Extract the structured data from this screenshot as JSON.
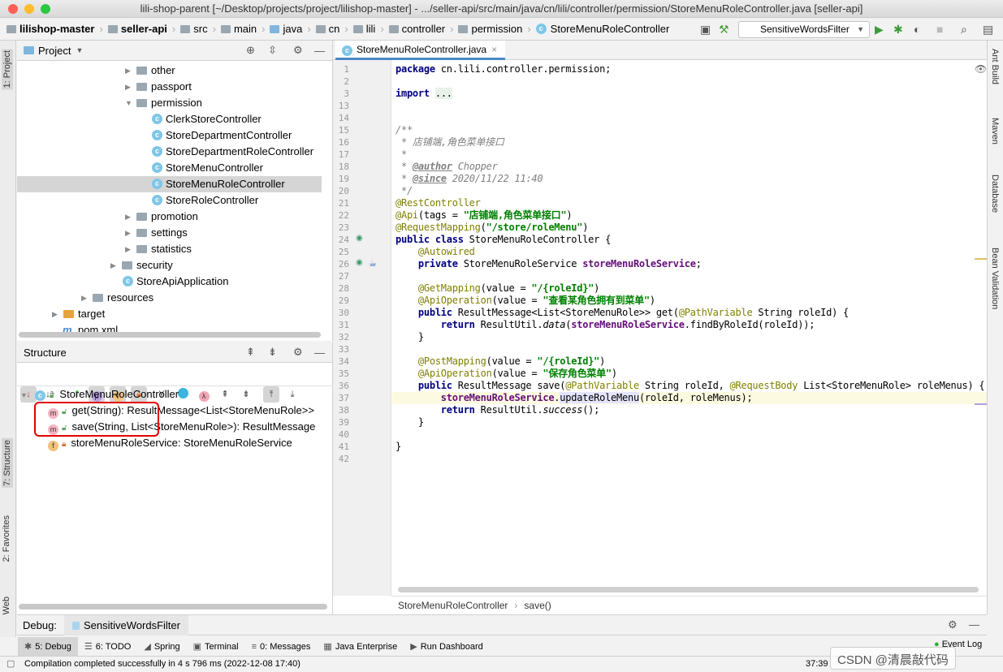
{
  "window": {
    "title": "lili-shop-parent [~/Desktop/projects/project/lilishop-master] - .../seller-api/src/main/java/cn/lili/controller/permission/StoreMenuRoleController.java [seller-api]"
  },
  "breadcrumbs": [
    "lilishop-master",
    "seller-api",
    "src",
    "main",
    "java",
    "cn",
    "lili",
    "controller",
    "permission",
    "StoreMenuRoleController"
  ],
  "run_config": {
    "selected": "SensitiveWordsFilter"
  },
  "left_strip": {
    "project": "1: Project",
    "structure": "7: Structure",
    "favorites": "2: Favorites",
    "web": "Web"
  },
  "right_strip": {
    "ant": "Ant Build",
    "maven": "Maven",
    "database": "Database",
    "bean": "Bean Validation"
  },
  "project_panel": {
    "title": "Project",
    "items": [
      {
        "label": "other",
        "type": "folder"
      },
      {
        "label": "passport",
        "type": "folder"
      },
      {
        "label": "permission",
        "type": "folder",
        "expanded": true
      },
      {
        "label": "ClerkStoreController",
        "type": "class"
      },
      {
        "label": "StoreDepartmentController",
        "type": "class"
      },
      {
        "label": "StoreDepartmentRoleController",
        "type": "class"
      },
      {
        "label": "StoreMenuController",
        "type": "class"
      },
      {
        "label": "StoreMenuRoleController",
        "type": "class",
        "selected": true
      },
      {
        "label": "StoreRoleController",
        "type": "class"
      },
      {
        "label": "promotion",
        "type": "folder"
      },
      {
        "label": "settings",
        "type": "folder"
      },
      {
        "label": "statistics",
        "type": "folder"
      },
      {
        "label": "security",
        "type": "folder"
      },
      {
        "label": "StoreApiApplication",
        "type": "app"
      },
      {
        "label": "resources",
        "type": "folder"
      },
      {
        "label": "target",
        "type": "folder-orange"
      },
      {
        "label": "pom.xml",
        "type": "maven"
      }
    ]
  },
  "structure_panel": {
    "title": "Structure",
    "root": "StoreMenuRoleController",
    "members": [
      {
        "badge": "m",
        "label": "get(String): ResultMessage<List<StoreMenuRole>>"
      },
      {
        "badge": "m",
        "label": "save(String, List<StoreMenuRole>): ResultMessage"
      },
      {
        "badge": "f",
        "label": "storeMenuRoleService: StoreMenuRoleService"
      }
    ],
    "toolbar_badges": {
      "p": "p",
      "f": "f",
      "lambda": "λ"
    }
  },
  "editor": {
    "tab": "StoreMenuRoleController.java",
    "breadcrumb": [
      "StoreMenuRoleController",
      "save()"
    ],
    "current_line": 37,
    "lines": [
      {
        "n": "1",
        "t": [
          [
            "package",
            "kw"
          ],
          [
            " cn.lili.controller.permission;",
            ""
          ]
        ]
      },
      {
        "n": "2",
        "t": []
      },
      {
        "n": "3",
        "t": [
          [
            "import",
            "kw"
          ],
          [
            " ",
            ""
          ],
          [
            "...",
            "fold"
          ]
        ]
      },
      {
        "n": "13",
        "t": []
      },
      {
        "n": "14",
        "t": []
      },
      {
        "n": "15",
        "t": [
          [
            "/**",
            "cm"
          ]
        ]
      },
      {
        "n": "16",
        "t": [
          [
            " * 店铺端,角色菜单接口",
            "cm"
          ]
        ]
      },
      {
        "n": "17",
        "t": [
          [
            " *",
            "cm"
          ]
        ]
      },
      {
        "n": "18",
        "t": [
          [
            " * ",
            "cm"
          ],
          [
            "@author",
            "ct"
          ],
          [
            " Chopper",
            "cm"
          ]
        ]
      },
      {
        "n": "19",
        "t": [
          [
            " * ",
            "cm"
          ],
          [
            "@since",
            "ct"
          ],
          [
            " 2020/11/22 11:40",
            "cm"
          ]
        ]
      },
      {
        "n": "20",
        "t": [
          [
            " */",
            "cm"
          ]
        ]
      },
      {
        "n": "21",
        "t": [
          [
            "@RestController",
            "an"
          ]
        ]
      },
      {
        "n": "22",
        "t": [
          [
            "@Api",
            "an"
          ],
          [
            "(tags = ",
            ""
          ],
          [
            "\"店铺端,角色菜单接口\"",
            "st"
          ],
          [
            ")",
            ""
          ]
        ]
      },
      {
        "n": "23",
        "t": [
          [
            "@RequestMapping",
            "an"
          ],
          [
            "(",
            ""
          ],
          [
            "\"/store/roleMenu\"",
            "st"
          ],
          [
            ")",
            ""
          ]
        ]
      },
      {
        "n": "24",
        "t": [
          [
            "public class",
            "kw"
          ],
          [
            " StoreMenuRoleController {",
            ""
          ]
        ]
      },
      {
        "n": "25",
        "t": [
          [
            "    ",
            ""
          ],
          [
            "@Autowired",
            "an"
          ]
        ]
      },
      {
        "n": "26",
        "t": [
          [
            "    ",
            ""
          ],
          [
            "private",
            "kw"
          ],
          [
            " StoreMenuRoleService ",
            ""
          ],
          [
            "storeMenuRoleService",
            "fd"
          ],
          [
            ";",
            ""
          ]
        ]
      },
      {
        "n": "27",
        "t": []
      },
      {
        "n": "28",
        "t": [
          [
            "    ",
            ""
          ],
          [
            "@GetMapping",
            "an"
          ],
          [
            "(value = ",
            ""
          ],
          [
            "\"/{roleId}\"",
            "st"
          ],
          [
            ")",
            ""
          ]
        ]
      },
      {
        "n": "29",
        "t": [
          [
            "    ",
            ""
          ],
          [
            "@ApiOperation",
            "an"
          ],
          [
            "(value = ",
            ""
          ],
          [
            "\"查看某角色拥有到菜单\"",
            "st"
          ],
          [
            ")",
            ""
          ]
        ]
      },
      {
        "n": "30",
        "t": [
          [
            "    ",
            ""
          ],
          [
            "public",
            "kw"
          ],
          [
            " ResultMessage<List<StoreMenuRole>> get(",
            ""
          ],
          [
            "@PathVariable",
            "an"
          ],
          [
            " String roleId) {",
            ""
          ]
        ]
      },
      {
        "n": "31",
        "t": [
          [
            "        ",
            ""
          ],
          [
            "return",
            "kw"
          ],
          [
            " ResultUtil.",
            ""
          ],
          [
            "data",
            "it"
          ],
          [
            "(",
            ""
          ],
          [
            "storeMenuRoleService",
            "fd"
          ],
          [
            ".findByRoleId(roleId));",
            ""
          ]
        ]
      },
      {
        "n": "32",
        "t": [
          [
            "    }",
            ""
          ]
        ]
      },
      {
        "n": "33",
        "t": []
      },
      {
        "n": "34",
        "t": [
          [
            "    ",
            ""
          ],
          [
            "@PostMapping",
            "an"
          ],
          [
            "(value = ",
            ""
          ],
          [
            "\"/{roleId}\"",
            "st"
          ],
          [
            ")",
            ""
          ]
        ]
      },
      {
        "n": "35",
        "t": [
          [
            "    ",
            ""
          ],
          [
            "@ApiOperation",
            "an"
          ],
          [
            "(value = ",
            ""
          ],
          [
            "\"保存角色菜单\"",
            "st"
          ],
          [
            ")",
            ""
          ]
        ]
      },
      {
        "n": "36",
        "t": [
          [
            "    ",
            ""
          ],
          [
            "public",
            "kw"
          ],
          [
            " ResultMessage save(",
            ""
          ],
          [
            "@PathVariable",
            "an"
          ],
          [
            " String roleId, ",
            ""
          ],
          [
            "@RequestBody",
            "an"
          ],
          [
            " List<StoreMenuRole> roleMenus) {",
            ""
          ]
        ]
      },
      {
        "n": "37",
        "t": [
          [
            "        ",
            ""
          ],
          [
            "storeMenuRoleService",
            "fd"
          ],
          [
            ".",
            ""
          ],
          [
            "updateRoleMenu",
            "mh"
          ],
          [
            "(roleId, roleMenus);",
            ""
          ]
        ]
      },
      {
        "n": "38",
        "t": [
          [
            "        ",
            ""
          ],
          [
            "return",
            "kw"
          ],
          [
            " ResultUtil.",
            ""
          ],
          [
            "success",
            "it"
          ],
          [
            "();",
            ""
          ]
        ]
      },
      {
        "n": "39",
        "t": [
          [
            "    }",
            ""
          ]
        ]
      },
      {
        "n": "40",
        "t": []
      },
      {
        "n": "41",
        "t": [
          [
            "}",
            ""
          ]
        ]
      },
      {
        "n": "42",
        "t": []
      }
    ]
  },
  "debug": {
    "label": "Debug:",
    "session": "SensitiveWordsFilter"
  },
  "tool_windows": [
    {
      "key": "5",
      "label": "5: Debug",
      "active": true
    },
    {
      "key": "6",
      "label": "6: TODO"
    },
    {
      "label": "Spring"
    },
    {
      "label": "Terminal"
    },
    {
      "key": "0",
      "label": "0: Messages"
    },
    {
      "label": "Java Enterprise"
    },
    {
      "label": "Run Dashboard"
    }
  ],
  "event_log": "Event Log",
  "status": {
    "message": "Compilation completed successfully in 4 s 796 ms (2022-12-08 17:40)",
    "position": "37:39"
  },
  "watermark": "CSDN @清晨敲代码",
  "colors": {
    "accent": "#4a88c7",
    "selection": "#d5d5d5",
    "highlight_box": "#e00000",
    "current_line": "#fcfae0"
  }
}
